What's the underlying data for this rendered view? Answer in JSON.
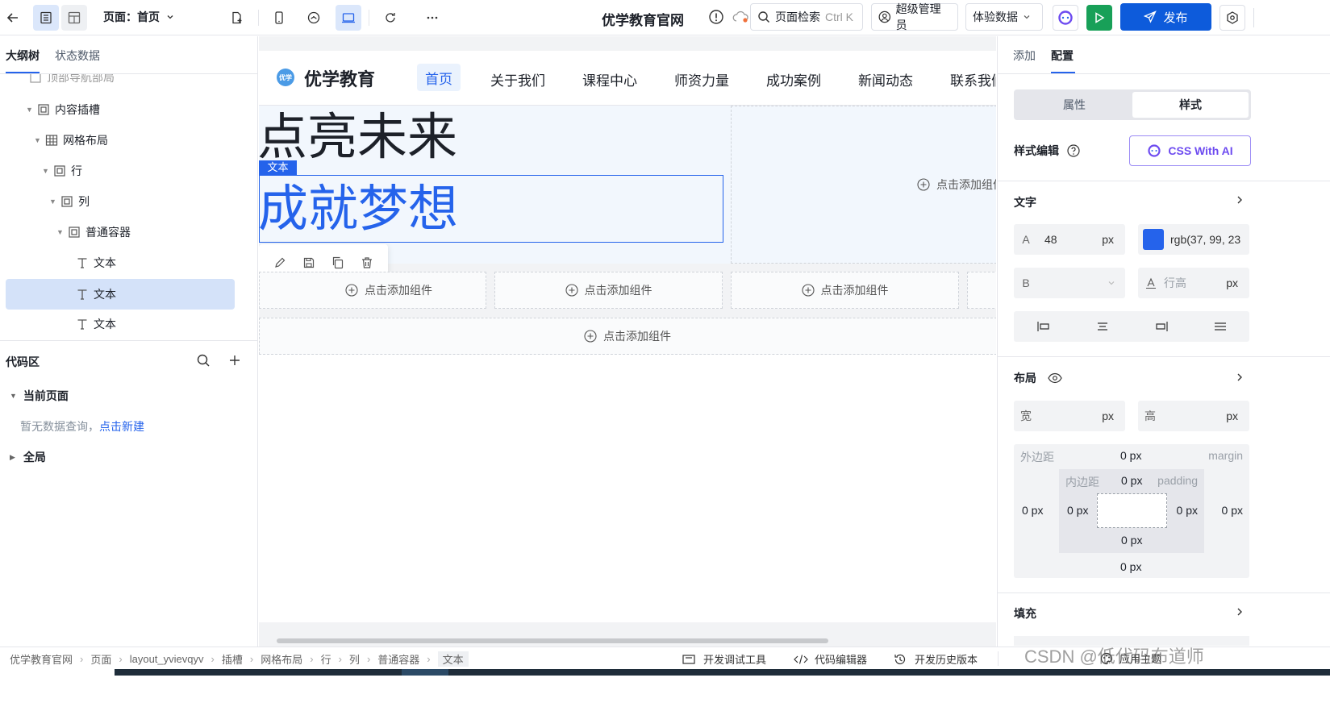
{
  "topbar": {
    "page_label": "页面：首页",
    "app_title": "优学教育官网",
    "search_label": "页面检索",
    "search_shortcut": "Ctrl K",
    "user_label": "超级管理员",
    "env_label": "体验数据",
    "publish_label": "发布"
  },
  "left": {
    "tabs": [
      "大纲树",
      "状态数据"
    ],
    "tree": [
      {
        "label": "顶部导航部局",
        "depth": 3
      },
      {
        "label": "内容插槽",
        "depth": 3
      },
      {
        "label": "网格布局",
        "depth": 4
      },
      {
        "label": "行",
        "depth": 5
      },
      {
        "label": "列",
        "depth": 6
      },
      {
        "label": "普通容器",
        "depth": 7
      },
      {
        "label": "文本",
        "depth": 8
      },
      {
        "label": "文本",
        "depth": 8
      },
      {
        "label": "文本",
        "depth": 8
      }
    ],
    "code_title": "代码区",
    "current_page": "当前页面",
    "empty_text": "暂无数据查询，",
    "empty_link": "点击新建",
    "global": "全局"
  },
  "canvas": {
    "brand": "优学教育",
    "logo_text": "优学",
    "nav": [
      "首页",
      "关于我们",
      "课程中心",
      "师资力量",
      "成功案例",
      "新闻动态",
      "联系我们"
    ],
    "hero_line1": "点亮未来",
    "hero_line2": "成就梦想",
    "selected_tag": "文本",
    "add_component": "点击添加组件"
  },
  "right": {
    "tabs": [
      "添加",
      "配置"
    ],
    "seg": [
      "属性",
      "样式"
    ],
    "style_edit": "样式编辑",
    "css_ai": "CSS With AI",
    "text_section": "文字",
    "font_prefix": "A",
    "font_size": "48",
    "unit_px": "px",
    "color_value": "rgb(37, 99, 23",
    "weight_prefix": "B",
    "line_height_placeholder": "行高",
    "layout_section": "布局",
    "width_label": "宽",
    "height_label": "高",
    "margin_cn": "外边距",
    "margin_en": "margin",
    "padding_cn": "内边距",
    "padding_en": "padding",
    "zero_px": "0 px",
    "fill_section": "填充",
    "accent": "#2563eb",
    "text_color": "#2563eb"
  },
  "bottom": {
    "crumbs": [
      "优学教育官网",
      "页面",
      "layout_yvievqyv",
      "插槽",
      "网格布局",
      "行",
      "列",
      "普通容器",
      "文本"
    ],
    "debug": "开发调试工具",
    "code_editor": "代码编辑器",
    "history": "开发历史版本",
    "theme": "应用主题",
    "watermark": "CSDN @低代码布道师"
  }
}
